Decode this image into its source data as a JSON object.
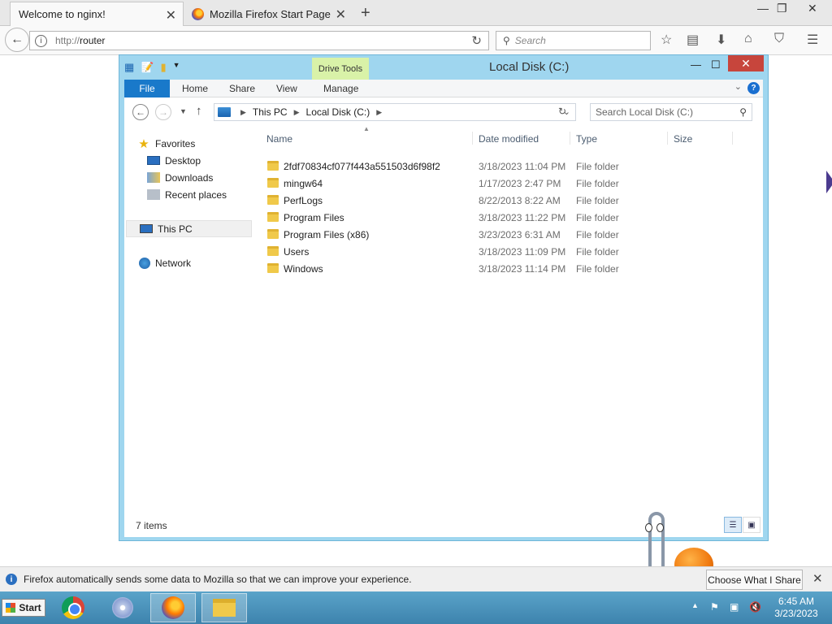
{
  "browser": {
    "tabs": [
      {
        "label": "Welcome to nginx!"
      },
      {
        "label": "Mozilla Firefox Start Page"
      }
    ],
    "url_protocol": "http://",
    "url_host": "router",
    "search_placeholder": "Search"
  },
  "explorer": {
    "title": "Local Disk (C:)",
    "context_tab": "Drive Tools",
    "ribbon_tabs": [
      "File",
      "Home",
      "Share",
      "View",
      "Manage"
    ],
    "breadcrumb": [
      "This PC",
      "Local Disk (C:)"
    ],
    "search_placeholder": "Search Local Disk (C:)",
    "nav": {
      "favorites": "Favorites",
      "desktop": "Desktop",
      "downloads": "Downloads",
      "recent": "Recent places",
      "this_pc": "This PC",
      "network": "Network"
    },
    "columns": {
      "name": "Name",
      "date": "Date modified",
      "type": "Type",
      "size": "Size"
    },
    "rows": [
      {
        "name": "2fdf70834cf077f443a551503d6f98f2",
        "date": "3/18/2023 11:04 PM",
        "type": "File folder"
      },
      {
        "name": "mingw64",
        "date": "1/17/2023 2:47 PM",
        "type": "File folder"
      },
      {
        "name": "PerfLogs",
        "date": "8/22/2013 8:22 AM",
        "type": "File folder"
      },
      {
        "name": "Program Files",
        "date": "3/18/2023 11:22 PM",
        "type": "File folder"
      },
      {
        "name": "Program Files (x86)",
        "date": "3/23/2023 6:31 AM",
        "type": "File folder"
      },
      {
        "name": "Users",
        "date": "3/18/2023 11:09 PM",
        "type": "File folder"
      },
      {
        "name": "Windows",
        "date": "3/18/2023 11:14 PM",
        "type": "File folder"
      }
    ],
    "status": "7 items"
  },
  "notification": {
    "message": "Firefox automatically sends some data to Mozilla so that we can improve your experience.",
    "button": "Choose What I Share"
  },
  "taskbar": {
    "start": "Start",
    "time": "6:45 AM",
    "date": "3/23/2023"
  }
}
